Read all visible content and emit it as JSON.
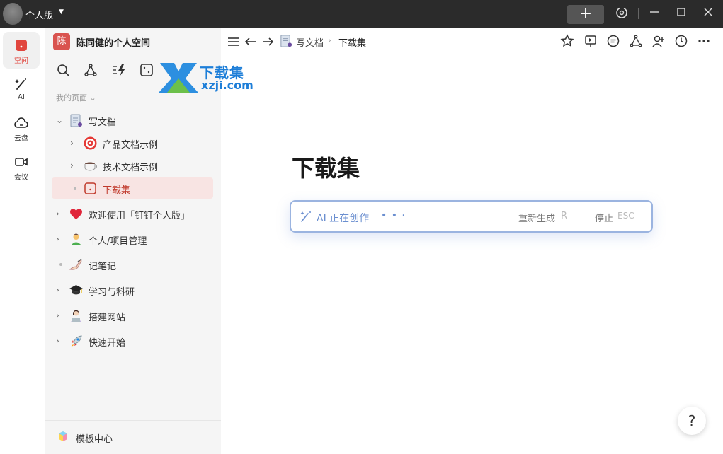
{
  "titlebar": {
    "edition": "个人版",
    "new_label": "+",
    "icons": [
      "sync-icon",
      "minimize-icon",
      "maximize-icon",
      "close-icon"
    ]
  },
  "rail": {
    "items": [
      {
        "label": "空间",
        "icon": "space-icon",
        "active": true
      },
      {
        "label": "AI",
        "icon": "ai-wand-icon",
        "active": false
      },
      {
        "label": "云盘",
        "icon": "cloud-icon",
        "active": false
      },
      {
        "label": "会议",
        "icon": "video-icon",
        "active": false
      }
    ]
  },
  "sidebar": {
    "workspace_logo": "陈",
    "workspace_name": "陈同健的个人空间",
    "tools": [
      "search-icon",
      "graph-icon",
      "flash-icon",
      "template-icon"
    ],
    "section_label": "我的页面",
    "tree": [
      {
        "label": "写文档",
        "level": 0,
        "expand": "open",
        "emoji": "doc"
      },
      {
        "label": "产品文档示例",
        "level": 1,
        "expand": "closed",
        "emoji": "target"
      },
      {
        "label": "技术文档示例",
        "level": 1,
        "expand": "closed",
        "emoji": "coffee"
      },
      {
        "label": "下载集",
        "level": 1,
        "expand": "leaf",
        "emoji": "page",
        "selected": true
      },
      {
        "label": "欢迎使用「钉钉个人版」",
        "level": 0,
        "expand": "closed",
        "emoji": "heart"
      },
      {
        "label": "个人/项目管理",
        "level": 0,
        "expand": "closed",
        "emoji": "person"
      },
      {
        "label": "记笔记",
        "level": 0,
        "expand": "leaf",
        "emoji": "writing"
      },
      {
        "label": "学习与科研",
        "level": 0,
        "expand": "closed",
        "emoji": "graduation"
      },
      {
        "label": "搭建网站",
        "level": 0,
        "expand": "closed",
        "emoji": "technologist"
      },
      {
        "label": "快速开始",
        "level": 0,
        "expand": "closed",
        "emoji": "rocket"
      }
    ],
    "footer_label": "模板中心"
  },
  "main": {
    "breadcrumb": [
      "写文档",
      "下载集"
    ],
    "breadcrumb_sep": "›",
    "actions": [
      "star-icon",
      "present-icon",
      "comment-icon",
      "share-icon",
      "add-user-icon",
      "history-icon",
      "more-icon"
    ],
    "watermark": {
      "title": "下载集",
      "url": "xzji.com"
    },
    "page_title": "下载集",
    "ai": {
      "status": "AI 正在创作",
      "dots": "• • ·",
      "regenerate": "重新生成",
      "regenerate_key": "R",
      "stop": "停止",
      "stop_key": "ESC"
    },
    "help": "?"
  },
  "colors": {
    "accent": "#e1463e",
    "ai_blue": "#6b8fd0",
    "selected_bg": "#f8e4e3"
  }
}
